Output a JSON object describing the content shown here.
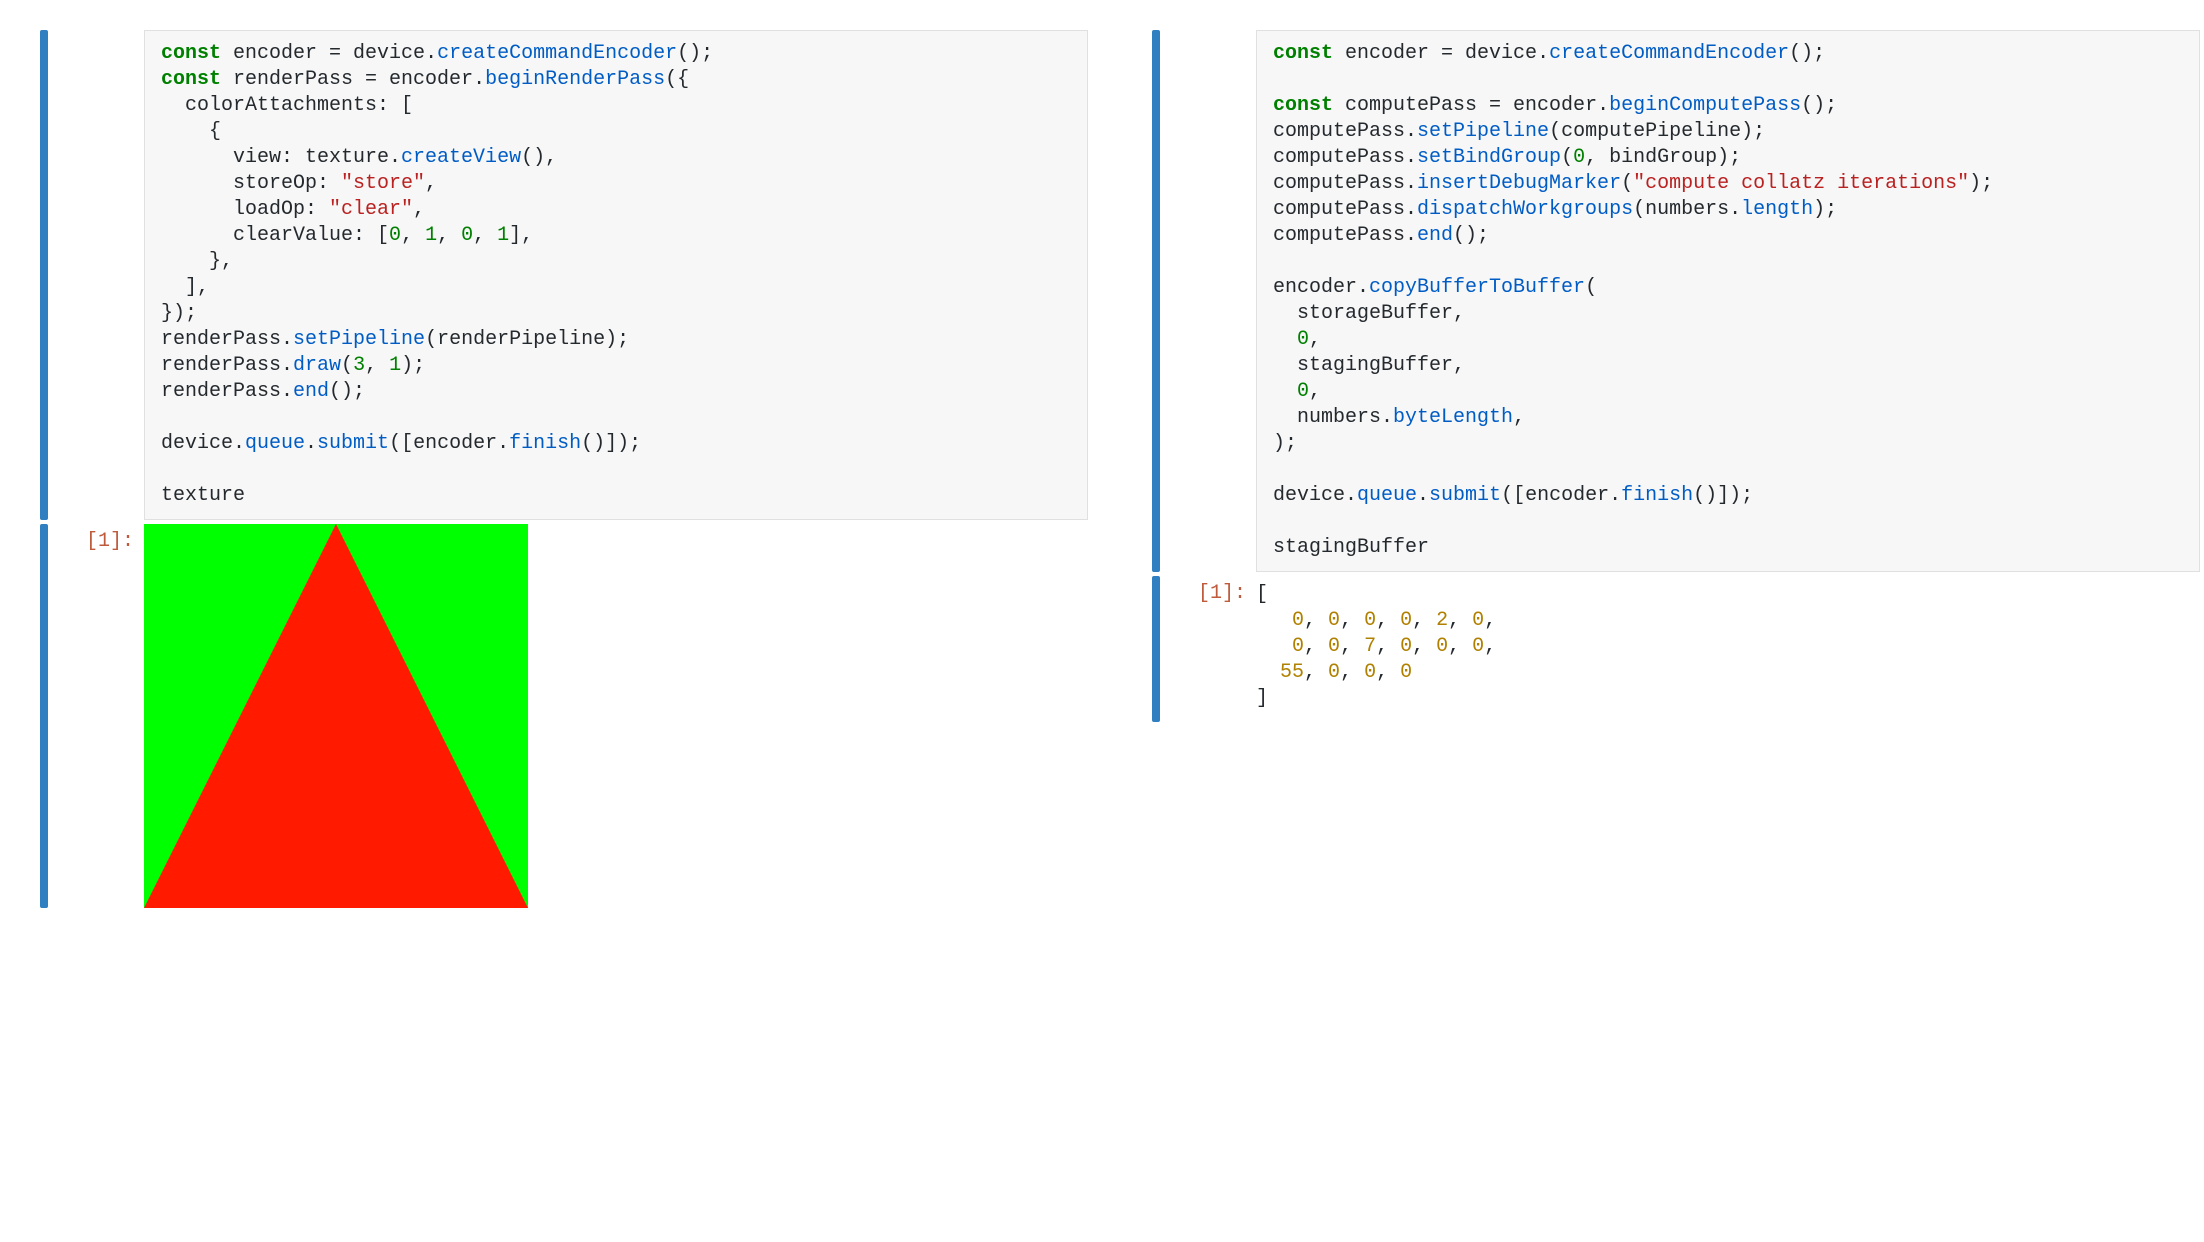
{
  "left": {
    "prompt_out": "[1]:",
    "code_tokens": [
      [
        [
          "kw",
          "const"
        ],
        [
          "id",
          " encoder "
        ],
        [
          "id",
          "= device."
        ],
        [
          "call",
          "createCommandEncoder"
        ],
        [
          "id",
          "();"
        ]
      ],
      [
        [
          "kw",
          "const"
        ],
        [
          "id",
          " renderPass "
        ],
        [
          "id",
          "= encoder."
        ],
        [
          "call",
          "beginRenderPass"
        ],
        [
          "id",
          "({"
        ]
      ],
      [
        [
          "id",
          "  colorAttachments: ["
        ]
      ],
      [
        [
          "id",
          "    {"
        ]
      ],
      [
        [
          "id",
          "      view: texture."
        ],
        [
          "call",
          "createView"
        ],
        [
          "id",
          "(),"
        ]
      ],
      [
        [
          "id",
          "      storeOp: "
        ],
        [
          "str",
          "\"store\""
        ],
        [
          "id",
          ","
        ]
      ],
      [
        [
          "id",
          "      loadOp: "
        ],
        [
          "str",
          "\"clear\""
        ],
        [
          "id",
          ","
        ]
      ],
      [
        [
          "id",
          "      clearValue: ["
        ],
        [
          "num",
          "0"
        ],
        [
          "id",
          ", "
        ],
        [
          "num",
          "1"
        ],
        [
          "id",
          ", "
        ],
        [
          "num",
          "0"
        ],
        [
          "id",
          ", "
        ],
        [
          "num",
          "1"
        ],
        [
          "id",
          "],"
        ]
      ],
      [
        [
          "id",
          "    },"
        ]
      ],
      [
        [
          "id",
          "  ],"
        ]
      ],
      [
        [
          "id",
          "});"
        ]
      ],
      [
        [
          "id",
          "renderPass."
        ],
        [
          "call",
          "setPipeline"
        ],
        [
          "id",
          "(renderPipeline);"
        ]
      ],
      [
        [
          "id",
          "renderPass."
        ],
        [
          "call",
          "draw"
        ],
        [
          "id",
          "("
        ],
        [
          "num",
          "3"
        ],
        [
          "id",
          ", "
        ],
        [
          "num",
          "1"
        ],
        [
          "id",
          ");"
        ]
      ],
      [
        [
          "id",
          "renderPass."
        ],
        [
          "call",
          "end"
        ],
        [
          "id",
          "();"
        ]
      ],
      [
        [
          "id",
          ""
        ]
      ],
      [
        [
          "id",
          "device."
        ],
        [
          "call",
          "queue"
        ],
        [
          "id",
          "."
        ],
        [
          "call",
          "submit"
        ],
        [
          "id",
          "([encoder."
        ],
        [
          "call",
          "finish"
        ],
        [
          "id",
          "()]);"
        ]
      ],
      [
        [
          "id",
          ""
        ]
      ],
      [
        [
          "id",
          "texture"
        ]
      ]
    ],
    "triangle": {
      "bg": "#00ff00",
      "fg": "#ff1a00",
      "size": 384
    }
  },
  "right": {
    "prompt_out": "[1]:",
    "code_tokens": [
      [
        [
          "kw",
          "const"
        ],
        [
          "id",
          " encoder "
        ],
        [
          "id",
          "= device."
        ],
        [
          "call",
          "createCommandEncoder"
        ],
        [
          "id",
          "();"
        ]
      ],
      [
        [
          "id",
          ""
        ]
      ],
      [
        [
          "kw",
          "const"
        ],
        [
          "id",
          " computePass "
        ],
        [
          "id",
          "= encoder."
        ],
        [
          "call",
          "beginComputePass"
        ],
        [
          "id",
          "();"
        ]
      ],
      [
        [
          "id",
          "computePass."
        ],
        [
          "call",
          "setPipeline"
        ],
        [
          "id",
          "(computePipeline);"
        ]
      ],
      [
        [
          "id",
          "computePass."
        ],
        [
          "call",
          "setBindGroup"
        ],
        [
          "id",
          "("
        ],
        [
          "num",
          "0"
        ],
        [
          "id",
          ", bindGroup);"
        ]
      ],
      [
        [
          "id",
          "computePass."
        ],
        [
          "call",
          "insertDebugMarker"
        ],
        [
          "id",
          "("
        ],
        [
          "str",
          "\"compute collatz iterations\""
        ],
        [
          "id",
          ");"
        ]
      ],
      [
        [
          "id",
          "computePass."
        ],
        [
          "call",
          "dispatchWorkgroups"
        ],
        [
          "id",
          "(numbers."
        ],
        [
          "call",
          "length"
        ],
        [
          "id",
          ");"
        ]
      ],
      [
        [
          "id",
          "computePass."
        ],
        [
          "call",
          "end"
        ],
        [
          "id",
          "();"
        ]
      ],
      [
        [
          "id",
          ""
        ]
      ],
      [
        [
          "id",
          "encoder."
        ],
        [
          "call",
          "copyBufferToBuffer"
        ],
        [
          "id",
          "("
        ]
      ],
      [
        [
          "id",
          "  storageBuffer,"
        ]
      ],
      [
        [
          "id",
          "  "
        ],
        [
          "num",
          "0"
        ],
        [
          "id",
          ","
        ]
      ],
      [
        [
          "id",
          "  stagingBuffer,"
        ]
      ],
      [
        [
          "id",
          "  "
        ],
        [
          "num",
          "0"
        ],
        [
          "id",
          ","
        ]
      ],
      [
        [
          "id",
          "  numbers."
        ],
        [
          "call",
          "byteLength"
        ],
        [
          "id",
          ","
        ]
      ],
      [
        [
          "id",
          ");"
        ]
      ],
      [
        [
          "id",
          ""
        ]
      ],
      [
        [
          "id",
          "device."
        ],
        [
          "call",
          "queue"
        ],
        [
          "id",
          "."
        ],
        [
          "call",
          "submit"
        ],
        [
          "id",
          "([encoder."
        ],
        [
          "call",
          "finish"
        ],
        [
          "id",
          "()]);"
        ]
      ],
      [
        [
          "id",
          ""
        ]
      ],
      [
        [
          "id",
          "stagingBuffer"
        ]
      ]
    ],
    "output_tokens": [
      [
        [
          "id",
          "["
        ]
      ],
      [
        [
          "id",
          "   "
        ],
        [
          "out-num",
          "0"
        ],
        [
          "id",
          ", "
        ],
        [
          "out-num",
          "0"
        ],
        [
          "id",
          ", "
        ],
        [
          "out-num",
          "0"
        ],
        [
          "id",
          ", "
        ],
        [
          "out-num",
          "0"
        ],
        [
          "id",
          ", "
        ],
        [
          "out-num",
          "2"
        ],
        [
          "id",
          ", "
        ],
        [
          "out-num",
          "0"
        ],
        [
          "id",
          ","
        ]
      ],
      [
        [
          "id",
          "   "
        ],
        [
          "out-num",
          "0"
        ],
        [
          "id",
          ", "
        ],
        [
          "out-num",
          "0"
        ],
        [
          "id",
          ", "
        ],
        [
          "out-num",
          "7"
        ],
        [
          "id",
          ", "
        ],
        [
          "out-num",
          "0"
        ],
        [
          "id",
          ", "
        ],
        [
          "out-num",
          "0"
        ],
        [
          "id",
          ", "
        ],
        [
          "out-num",
          "0"
        ],
        [
          "id",
          ","
        ]
      ],
      [
        [
          "id",
          "  "
        ],
        [
          "out-num",
          "55"
        ],
        [
          "id",
          ", "
        ],
        [
          "out-num",
          "0"
        ],
        [
          "id",
          ", "
        ],
        [
          "out-num",
          "0"
        ],
        [
          "id",
          ", "
        ],
        [
          "out-num",
          "0"
        ]
      ],
      [
        [
          "id",
          "]"
        ]
      ]
    ]
  },
  "chart_data": {
    "type": "table",
    "title": "stagingBuffer contents",
    "values": [
      0,
      0,
      0,
      0,
      2,
      0,
      0,
      0,
      7,
      0,
      0,
      0,
      55,
      0,
      0,
      0
    ]
  }
}
